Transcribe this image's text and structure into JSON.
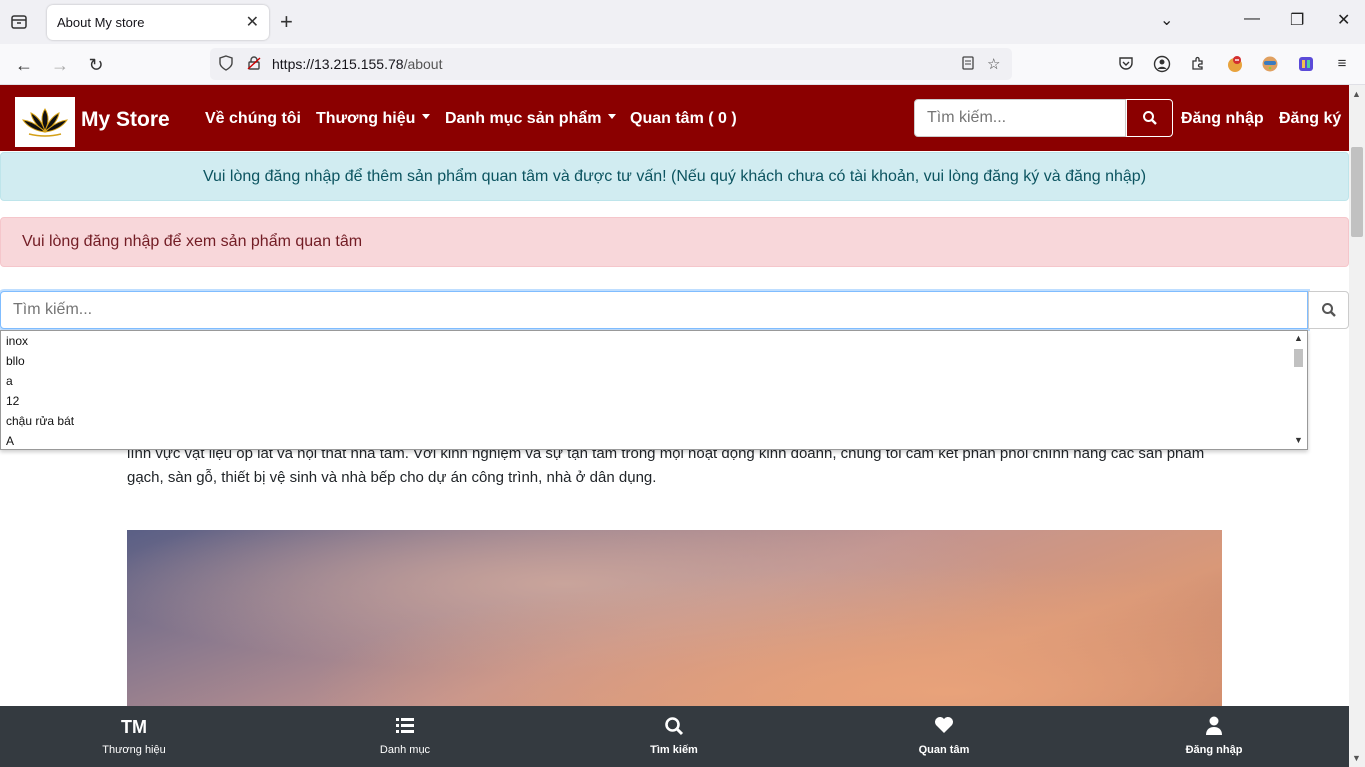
{
  "browser": {
    "tab_title": "About My store",
    "url_host": "https://13.215.155.78",
    "url_path": "/about"
  },
  "header": {
    "brand": "My Store",
    "menu": [
      {
        "label": "Về chúng tôi"
      },
      {
        "label": "Thương hiệu"
      },
      {
        "label": "Danh mục sản phẩm"
      },
      {
        "label": "Quan tâm ( 0 )"
      }
    ],
    "search_placeholder": "Tìm kiếm...",
    "login": "Đăng nhập",
    "register": "Đăng ký"
  },
  "alerts": {
    "info": "Vui lòng đăng nhập để thêm sản phẩm quan tâm và được tư vấn! (Nếu quý khách chưa có tài khoản, vui lòng đăng ký và đăng nhập)",
    "danger": "Vui lòng đăng nhập để xem sản phẩm quan tâm"
  },
  "main_search": {
    "placeholder": "Tìm kiếm...",
    "suggestions": [
      "inox",
      "bllo",
      "a",
      "12",
      "chậu rửa bát",
      "A"
    ]
  },
  "about": {
    "text": "lĩnh vực vật liệu ốp lát và nội thất nhà tắm. Với kinh nghiệm và sự tận tâm trong mọi hoạt động kinh doanh, chúng tôi cam kết phân phối chính hãng các sản phẩm gạch, sàn gỗ, thiết bị vệ sinh và nhà bếp cho dự án công trình, nhà ở dân dụng."
  },
  "bottom_nav": [
    {
      "icon": "TM",
      "label": "Thương hiệu"
    },
    {
      "icon": "list-icon",
      "label": "Danh mục"
    },
    {
      "icon": "search-icon",
      "label": "Tìm kiếm"
    },
    {
      "icon": "heart-icon",
      "label": "Quan tâm"
    },
    {
      "icon": "user-icon",
      "label": "Đăng nhập"
    }
  ],
  "colors": {
    "header_bg": "#8b0000",
    "info_bg": "#d1ecf1",
    "danger_bg": "#f8d7da",
    "bottom_nav_bg": "#343a40"
  }
}
